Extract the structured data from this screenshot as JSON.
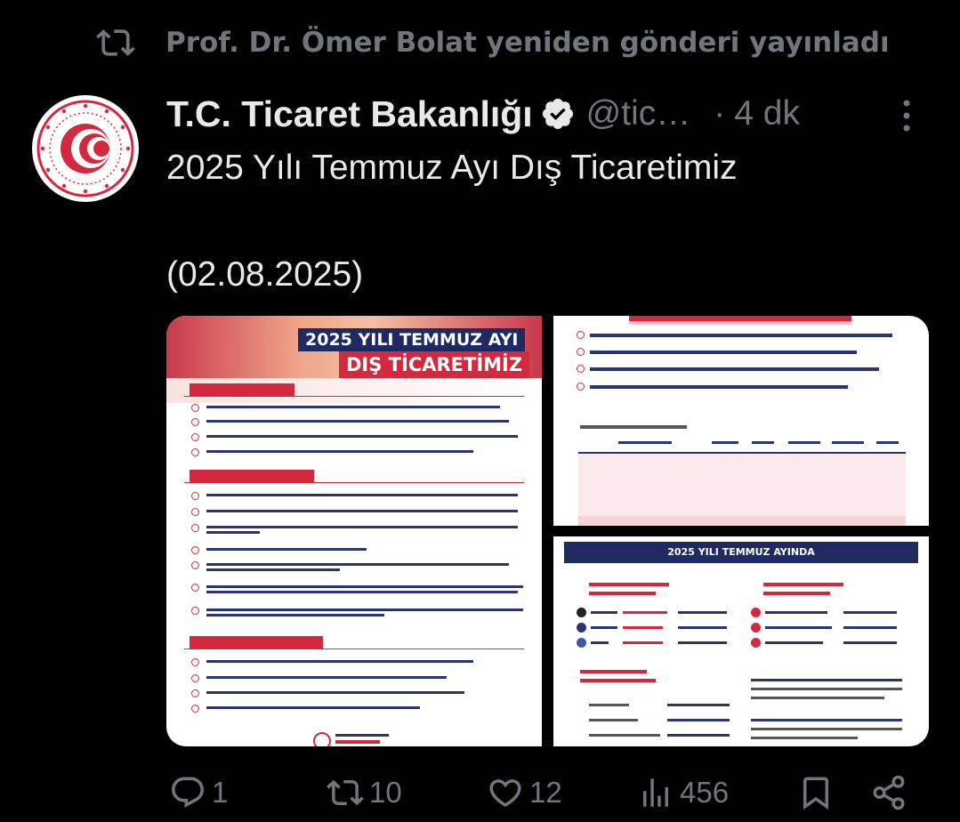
{
  "repost": {
    "text": "Prof. Dr. Ömer Bolat yeniden gönderi yayınladı",
    "icon": "repost-icon"
  },
  "tweet": {
    "author_name": "T.C. Ticaret Bakanlığı",
    "verified": true,
    "handle": "@tic…",
    "separator": "·",
    "time": "4 dk",
    "text_line1": "2025 Yılı Temmuz Ayı Dış Ticaretimiz",
    "text_line2": "(02.08.2025)"
  },
  "media": {
    "image1": {
      "title_line1": "2025 YILI TEMMUZ AYI",
      "title_line2": "DIŞ TİCARETİMİZ"
    },
    "image3": {
      "band_title": "2025 YILI TEMMUZ AYINDA"
    }
  },
  "actions": {
    "reply_count": "1",
    "repost_count": "10",
    "like_count": "12",
    "view_count": "456"
  },
  "colors": {
    "background": "#000000",
    "text_primary": "#e7e9ea",
    "text_secondary": "#71767b",
    "verified_blue": "#e7e9ea",
    "ministry_red": "#d3283e",
    "ministry_navy": "#1f2a63"
  }
}
